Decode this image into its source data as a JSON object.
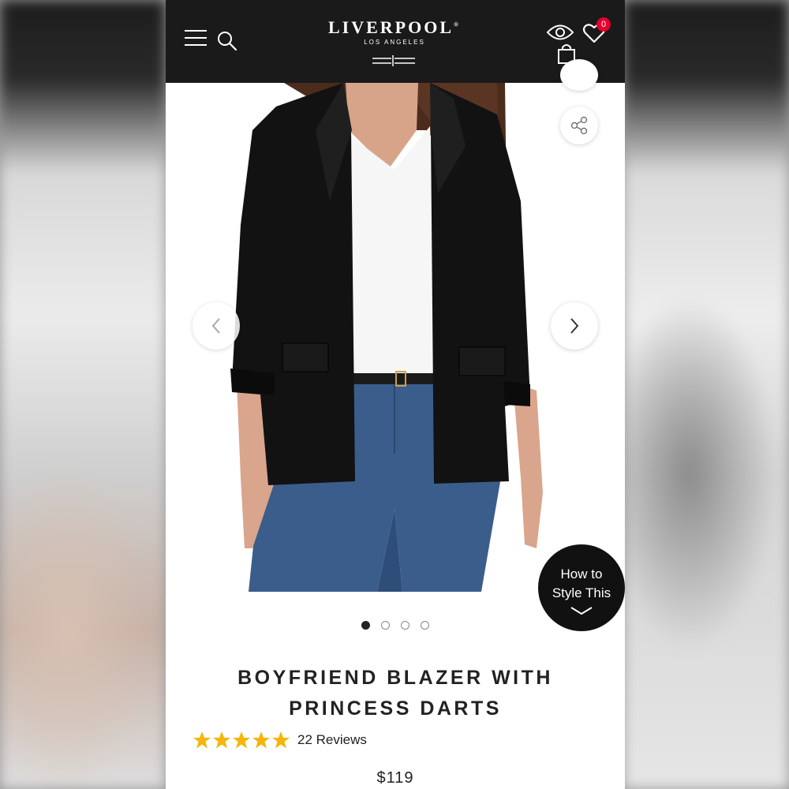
{
  "header": {
    "brand": "LIVERPOOL",
    "brand_registered": "®",
    "brand_sub": "LOS ANGELES",
    "cart_count": "0",
    "icons": [
      "menu-icon",
      "search-icon",
      "eye-icon",
      "heart-icon",
      "shopping-bag-icon"
    ]
  },
  "gallery": {
    "image_count": 4,
    "active_index": 0,
    "controls": [
      "share-icon",
      "chevron-left-icon",
      "chevron-right-icon"
    ]
  },
  "style_this": {
    "line1": "How to",
    "line2": "Style This"
  },
  "product": {
    "title_line1": "BOYFRIEND BLAZER WITH",
    "title_line2": "PRINCESS DARTS",
    "rating": 5,
    "reviews_label": "22 Reviews",
    "price": "$119"
  },
  "colors": {
    "header_bg": "#1a1a1a",
    "badge": "#e4002b",
    "star": "#f5b50a"
  }
}
